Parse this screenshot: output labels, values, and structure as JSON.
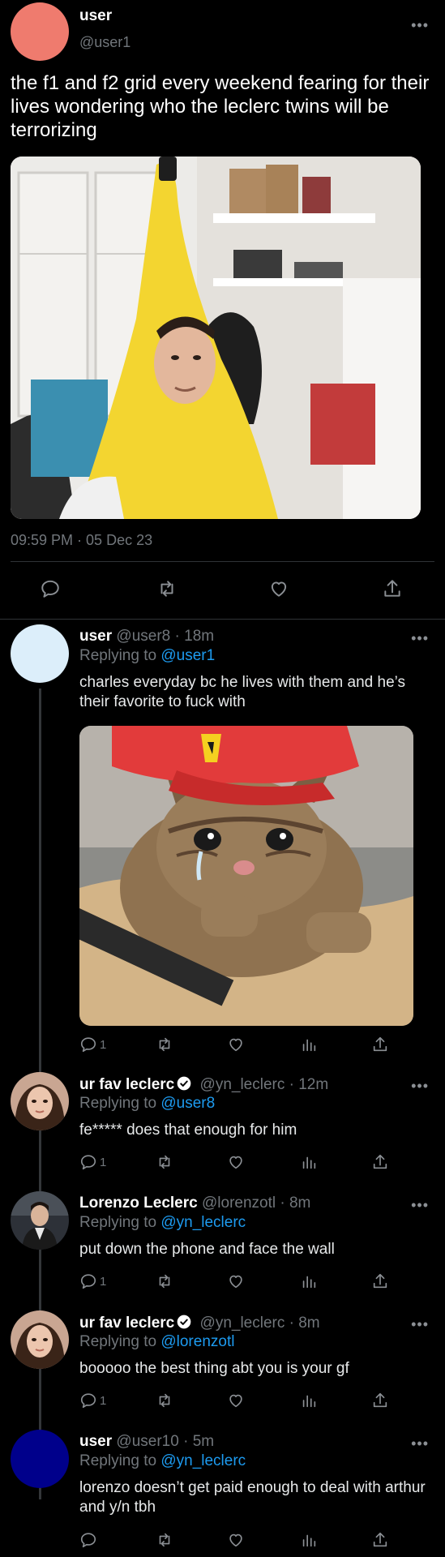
{
  "main_tweet": {
    "name": "user",
    "handle": "@user1",
    "text": "the f1 and f2 grid every weekend fearing for their lives wondering who the leclerc twins will be terrorizing",
    "timestamp": "09:59 PM · 05 Dec 23",
    "avatar_color": "#ef7b6e",
    "photo_alt": "person in banana costume"
  },
  "replies": [
    {
      "name": "user",
      "handle_time": "@user8 · 18m",
      "replying_prefix": "Replying to ",
      "replying_to": "@user1",
      "text": "charles everyday bc he lives with them and he’s their favorite to fuck with",
      "reply_count": "1",
      "verified": false,
      "avatar_color": "#dceefa"
    },
    {
      "name": "ur fav leclerc",
      "handle_time": "@yn_leclerc · 12m",
      "replying_prefix": "Replying to ",
      "replying_to": "@user8",
      "text": "fe***** does that enough for him",
      "reply_count": "1",
      "verified": true
    },
    {
      "name": "Lorenzo Leclerc",
      "handle_time": "@lorenzotl · 8m",
      "replying_prefix": "Replying to ",
      "replying_to": "@yn_leclerc",
      "text": "put down the phone and face the wall",
      "reply_count": "1",
      "verified": false
    },
    {
      "name": "ur fav leclerc",
      "handle_time": "@yn_leclerc · 8m",
      "replying_prefix": "Replying to ",
      "replying_to": "@lorenzotl",
      "text": "booooo the best thing abt you is your gf",
      "reply_count": "1",
      "verified": true
    },
    {
      "name": "user",
      "handle_time": "@user10 · 5m",
      "replying_prefix": "Replying to ",
      "replying_to": "@yn_leclerc",
      "text": "lorenzo doesn’t get paid enough to deal with arthur and y/n tbh",
      "reply_count": "",
      "verified": false,
      "avatar_color": "#00008b"
    }
  ],
  "icons": {
    "reply": "reply-icon",
    "retweet": "retweet-icon",
    "like": "heart-icon",
    "views": "views-icon",
    "share": "share-icon",
    "more": "more-icon",
    "verified": "verified-badge-icon"
  },
  "colors": {
    "background": "#000000",
    "muted": "#71767b",
    "link": "#1d9bf0",
    "divider": "#2f3336"
  }
}
